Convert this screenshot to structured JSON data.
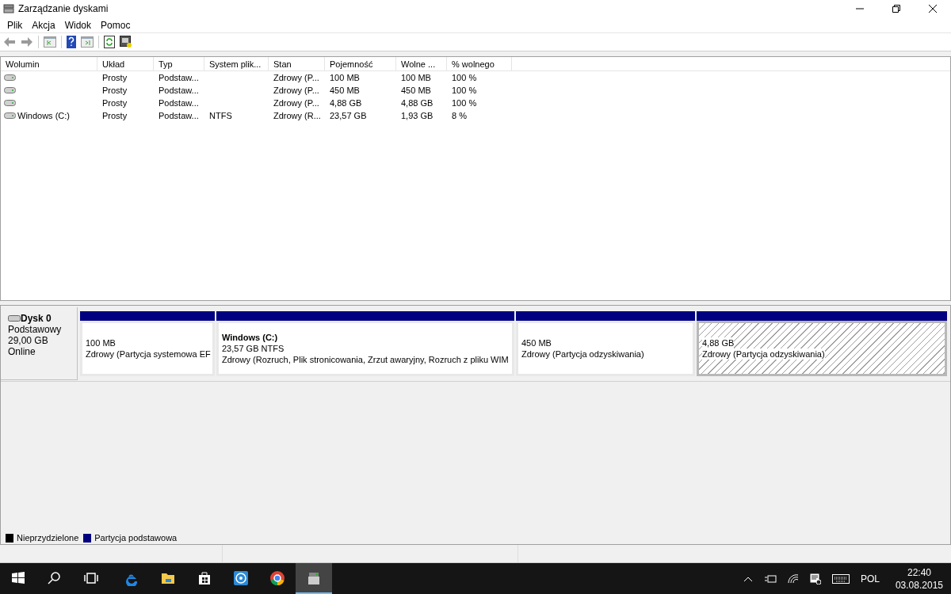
{
  "window": {
    "title": "Zarządzanie dyskami"
  },
  "menu": [
    "Plik",
    "Akcja",
    "Widok",
    "Pomoc"
  ],
  "table": {
    "columns": [
      "Wolumin",
      "Układ",
      "Typ",
      "System plik...",
      "Stan",
      "Pojemność",
      "Wolne ...",
      "% wolnego"
    ],
    "rows": [
      {
        "cells": [
          "",
          "Prosty",
          "Podstaw...",
          "",
          "Zdrowy (P...",
          "100 MB",
          "100 MB",
          "100 %"
        ]
      },
      {
        "cells": [
          "",
          "Prosty",
          "Podstaw...",
          "",
          "Zdrowy (P...",
          "450 MB",
          "450 MB",
          "100 %"
        ]
      },
      {
        "cells": [
          "",
          "Prosty",
          "Podstaw...",
          "",
          "Zdrowy (P...",
          "4,88 GB",
          "4,88 GB",
          "100 %"
        ]
      },
      {
        "cells": [
          "Windows (C:)",
          "Prosty",
          "Podstaw...",
          "NTFS",
          "Zdrowy (R...",
          "23,57 GB",
          "1,93 GB",
          "8 %"
        ]
      }
    ]
  },
  "disk": {
    "name": "Dysk 0",
    "type": "Podstawowy",
    "size": "29,00 GB",
    "status": "Online",
    "partitions": [
      {
        "size": "100 MB",
        "status": "Zdrowy (Partycja systemowa EF",
        "selected": false
      },
      {
        "title": "Windows  (C:)",
        "size": "23,57 GB NTFS",
        "status": "Zdrowy (Rozruch, Plik stronicowania, Zrzut awaryjny, Rozruch z pliku WIM",
        "selected": false
      },
      {
        "size": "450 MB",
        "status": "Zdrowy (Partycja odzyskiwania)",
        "selected": false
      },
      {
        "size": "4,88 GB",
        "status": "Zdrowy (Partycja odzyskiwania)",
        "selected": true
      }
    ]
  },
  "legend": [
    {
      "label": "Nieprzydzielone",
      "color": "#000000"
    },
    {
      "label": "Partycja podstawowa",
      "color": "#000080"
    }
  ],
  "taskbar": {
    "apps": [
      {
        "kind": "start",
        "selected": false
      },
      {
        "kind": "search",
        "selected": false
      },
      {
        "kind": "taskview",
        "selected": false
      },
      {
        "kind": "edge",
        "selected": false
      },
      {
        "kind": "explorer",
        "selected": false
      },
      {
        "kind": "store",
        "selected": false
      },
      {
        "kind": "app",
        "selected": false
      },
      {
        "kind": "chrome",
        "selected": false
      },
      {
        "kind": "diskmgmt",
        "selected": true
      }
    ],
    "language": "POL",
    "time": "22:40",
    "date": "03.08.2015"
  }
}
